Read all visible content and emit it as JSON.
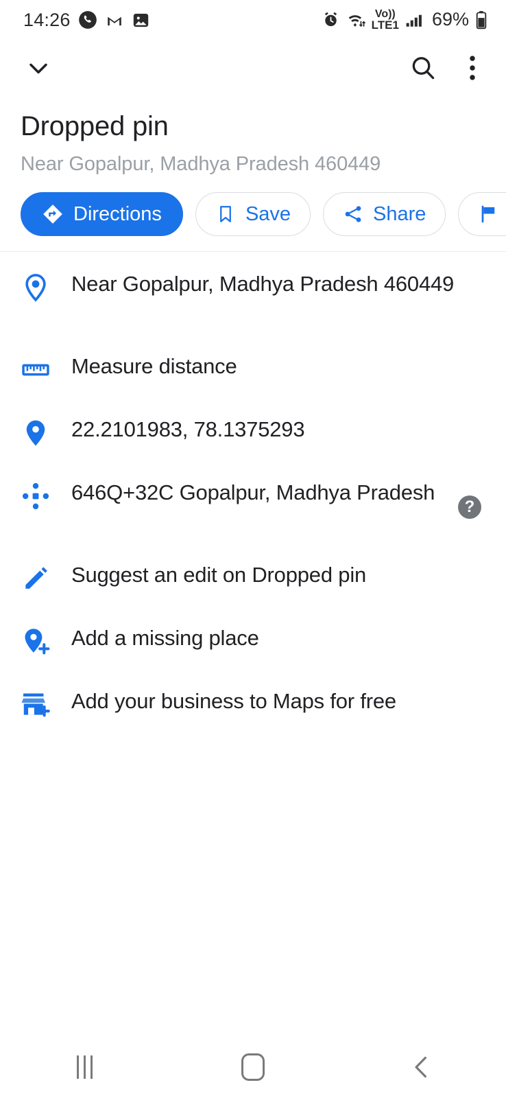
{
  "status_bar": {
    "time": "14:26",
    "battery_percent": "69%",
    "network_label": "LTE1",
    "volte_label": "Vo))",
    "icons": [
      "phone-icon",
      "gmail-icon",
      "photo-icon",
      "alarm-icon",
      "wifi-icon",
      "volte-icon",
      "signal-icon",
      "battery-icon"
    ]
  },
  "toolbar": {
    "collapse_icon": "chevron-down-icon",
    "search_icon": "search-icon",
    "overflow_icon": "more-vertical-icon"
  },
  "header": {
    "title": "Dropped pin",
    "subtitle": "Near Gopalpur, Madhya Pradesh 460449"
  },
  "chips": [
    {
      "label": "Directions",
      "icon": "directions-icon",
      "primary": true
    },
    {
      "label": "Save",
      "icon": "bookmark-icon",
      "primary": false
    },
    {
      "label": "Share",
      "icon": "share-icon",
      "primary": false
    },
    {
      "label": "",
      "icon": "flag-icon",
      "primary": false
    }
  ],
  "rows": [
    {
      "icon": "location-pin-outline-icon",
      "text": "Near Gopalpur, Madhya Pradesh 460449",
      "two_line": true,
      "help": false
    },
    {
      "icon": "ruler-icon",
      "text": "Measure distance",
      "two_line": false,
      "help": false
    },
    {
      "icon": "location-pin-filled-icon",
      "text": "22.2101983, 78.1375293",
      "two_line": false,
      "help": false
    },
    {
      "icon": "plus-code-icon",
      "text": "646Q+32C Gopalpur, Madhya Pradesh",
      "two_line": true,
      "help": true
    },
    {
      "icon": "pencil-icon",
      "text": "Suggest an edit on Dropped pin",
      "two_line": false,
      "help": false
    },
    {
      "icon": "add-place-icon",
      "text": "Add a missing place",
      "two_line": false,
      "help": false
    },
    {
      "icon": "add-business-icon",
      "text": "Add your business to Maps for free",
      "two_line": false,
      "help": false
    }
  ],
  "help_button": {
    "glyph": "?"
  },
  "nav_bar": {
    "recents_label": "recents-icon",
    "home_label": "home-icon",
    "back_label": "back-icon"
  },
  "colors": {
    "accent_blue": "#1a73e8",
    "text_primary": "#202124",
    "text_secondary": "#9aa0a6",
    "divider": "#e8eaed",
    "help_grey": "#70757a"
  }
}
